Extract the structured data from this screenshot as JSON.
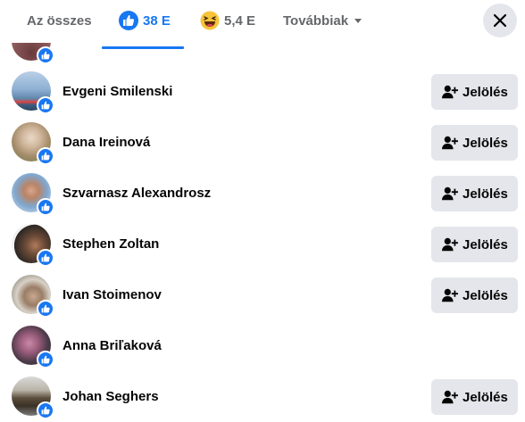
{
  "tabs": {
    "all_label": "Az összes",
    "like_count": "38 E",
    "haha_count": "5,4 E",
    "more_label": "Továbbiak"
  },
  "colors": {
    "accent": "#1877f2",
    "button_bg": "#e4e6eb",
    "muted": "#65676b"
  },
  "people": [
    {
      "name": "Evgeni Smilenski",
      "action": "Jelölés"
    },
    {
      "name": "Dana Ireinová",
      "action": "Jelölés"
    },
    {
      "name": "Szvarnasz Alexandrosz",
      "action": "Jelölés"
    },
    {
      "name": "Stephen Zoltan",
      "action": "Jelölés"
    },
    {
      "name": "Ivan Stoimenov",
      "action": "Jelölés"
    },
    {
      "name": "Anna Briľaková",
      "action": ""
    },
    {
      "name": "Johan Seghers",
      "action": "Jelölés"
    }
  ]
}
